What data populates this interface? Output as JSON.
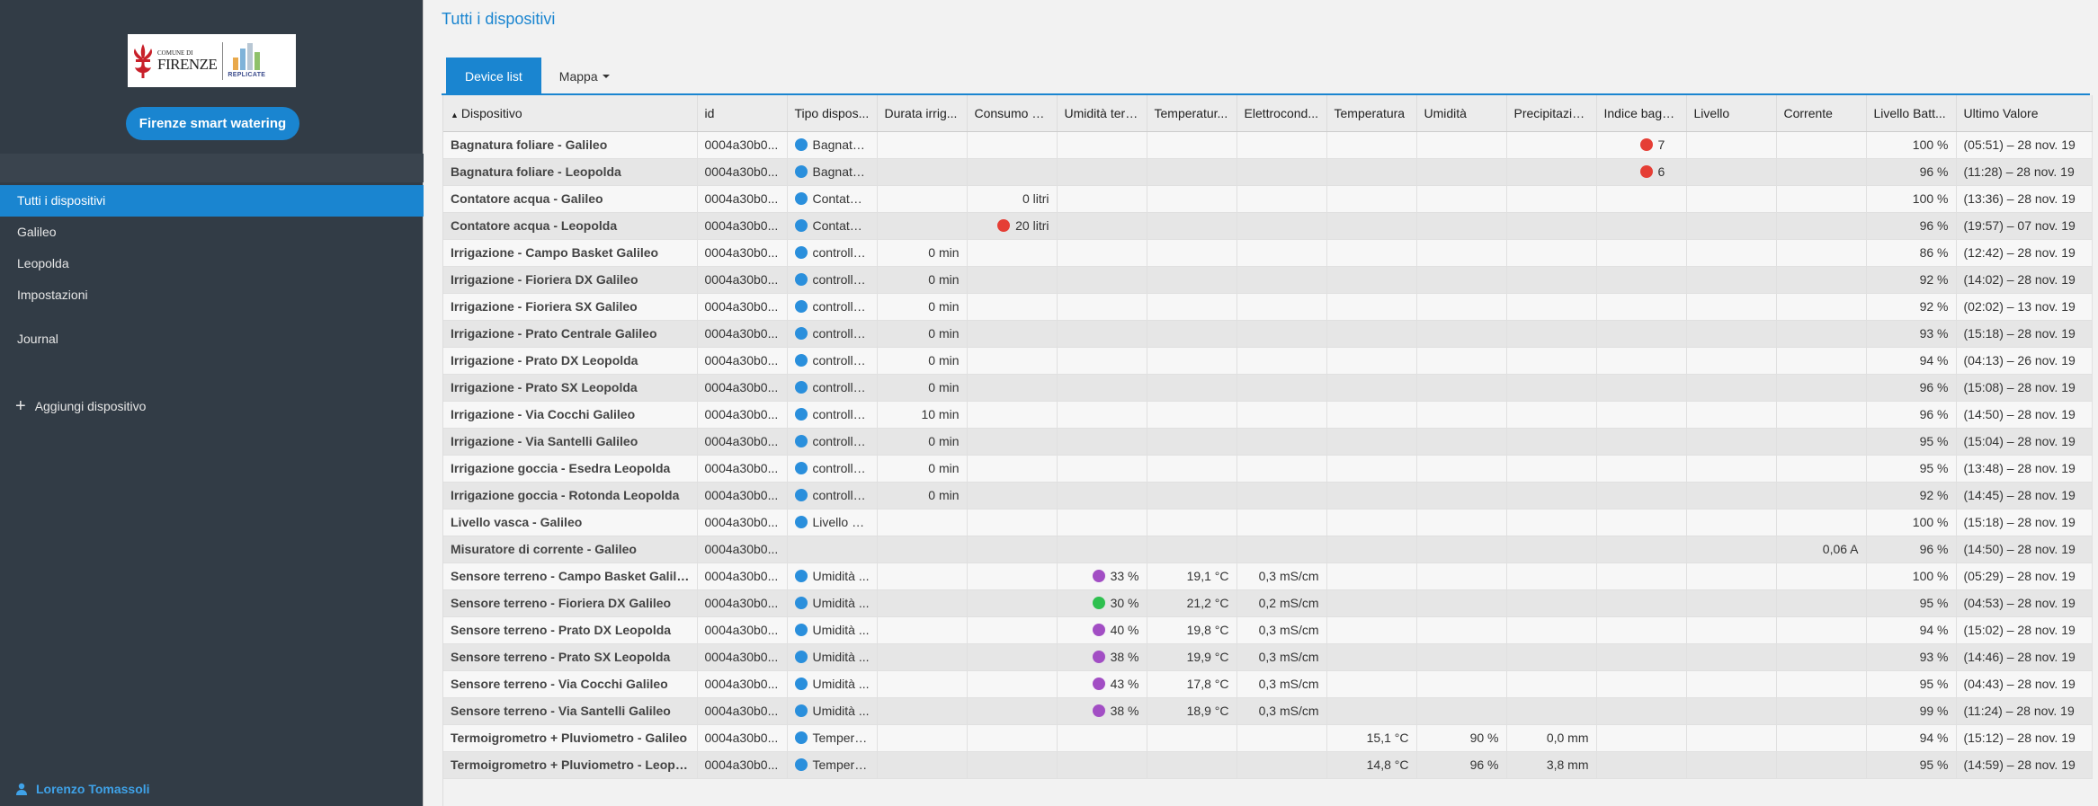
{
  "sidebar": {
    "logo": {
      "line1": "COMUNE DI",
      "line2": "FIRENZE",
      "partner": "REPLICATE"
    },
    "app_button": "Firenze smart watering",
    "nav": [
      {
        "label": "Tutti i dispositivi",
        "active": true
      },
      {
        "label": "Galileo"
      },
      {
        "label": "Leopolda"
      },
      {
        "label": "Impostazioni"
      },
      {
        "label": "Journal"
      }
    ],
    "add_device": "Aggiungi dispositivo",
    "user": "Lorenzo Tomassoli"
  },
  "main": {
    "title": "Tutti i dispositivi",
    "tabs": [
      {
        "label": "Device list",
        "active": true
      },
      {
        "label": "Mappa"
      }
    ]
  },
  "table": {
    "columns": [
      "Dispositivo",
      "id",
      "Tipo dispos...",
      "Durata irrig...",
      "Consumo a...",
      "Umidità terr...",
      "Temperatur...",
      "Elettrocond...",
      "Temperatura",
      "Umidità",
      "Precipitazio...",
      "Indice bagn...",
      "Livello",
      "Corrente",
      "Livello Batt...",
      "Ultimo Valore"
    ],
    "rows": [
      {
        "name": "Bagnatura foliare - Galileo",
        "id": "0004a30b0...",
        "type": "Bagnatu...",
        "durata": "",
        "consumo": "",
        "consumo_dot": "",
        "umid_terr": "",
        "umid_dot": "",
        "temp_terr": "",
        "ec": "",
        "temp": "",
        "umid": "",
        "prec": "",
        "indice": "7",
        "indice_dot": "red",
        "livello": "",
        "corrente": "",
        "batt": "100 %",
        "ultimo": "(05:51) – 28 nov. 19"
      },
      {
        "name": "Bagnatura foliare - Leopolda",
        "id": "0004a30b0...",
        "type": "Bagnatu...",
        "durata": "",
        "consumo": "",
        "consumo_dot": "",
        "umid_terr": "",
        "umid_dot": "",
        "temp_terr": "",
        "ec": "",
        "temp": "",
        "umid": "",
        "prec": "",
        "indice": "6",
        "indice_dot": "red",
        "livello": "",
        "corrente": "",
        "batt": "96 %",
        "ultimo": "(11:28) – 28 nov. 19"
      },
      {
        "name": "Contatore acqua - Galileo",
        "id": "0004a30b0...",
        "type": "Contator...",
        "durata": "",
        "consumo": "0 litri",
        "consumo_dot": "",
        "umid_terr": "",
        "umid_dot": "",
        "temp_terr": "",
        "ec": "",
        "temp": "",
        "umid": "",
        "prec": "",
        "indice": "",
        "indice_dot": "",
        "livello": "",
        "corrente": "",
        "batt": "100 %",
        "ultimo": "(13:36) – 28 nov. 19"
      },
      {
        "name": "Contatore acqua - Leopolda",
        "id": "0004a30b0...",
        "type": "Contator...",
        "durata": "",
        "consumo": "20 litri",
        "consumo_dot": "red",
        "umid_terr": "",
        "umid_dot": "",
        "temp_terr": "",
        "ec": "",
        "temp": "",
        "umid": "",
        "prec": "",
        "indice": "",
        "indice_dot": "",
        "livello": "",
        "corrente": "",
        "batt": "96 %",
        "ultimo": "(19:57) – 07 nov. 19"
      },
      {
        "name": "Irrigazione - Campo Basket Galileo",
        "id": "0004a30b0...",
        "type": "controlle...",
        "durata": "0 min",
        "consumo": "",
        "consumo_dot": "",
        "umid_terr": "",
        "umid_dot": "",
        "temp_terr": "",
        "ec": "",
        "temp": "",
        "umid": "",
        "prec": "",
        "indice": "",
        "indice_dot": "",
        "livello": "",
        "corrente": "",
        "batt": "86 %",
        "ultimo": "(12:42) – 28 nov. 19"
      },
      {
        "name": "Irrigazione - Fioriera DX Galileo",
        "id": "0004a30b0...",
        "type": "controlle...",
        "durata": "0 min",
        "consumo": "",
        "consumo_dot": "",
        "umid_terr": "",
        "umid_dot": "",
        "temp_terr": "",
        "ec": "",
        "temp": "",
        "umid": "",
        "prec": "",
        "indice": "",
        "indice_dot": "",
        "livello": "",
        "corrente": "",
        "batt": "92 %",
        "ultimo": "(14:02) – 28 nov. 19"
      },
      {
        "name": "Irrigazione - Fioriera SX Galileo",
        "id": "0004a30b0...",
        "type": "controlle...",
        "durata": "0 min",
        "consumo": "",
        "consumo_dot": "",
        "umid_terr": "",
        "umid_dot": "",
        "temp_terr": "",
        "ec": "",
        "temp": "",
        "umid": "",
        "prec": "",
        "indice": "",
        "indice_dot": "",
        "livello": "",
        "corrente": "",
        "batt": "92 %",
        "ultimo": "(02:02) – 13 nov. 19"
      },
      {
        "name": "Irrigazione - Prato Centrale Galileo",
        "id": "0004a30b0...",
        "type": "controlle...",
        "durata": "0 min",
        "consumo": "",
        "consumo_dot": "",
        "umid_terr": "",
        "umid_dot": "",
        "temp_terr": "",
        "ec": "",
        "temp": "",
        "umid": "",
        "prec": "",
        "indice": "",
        "indice_dot": "",
        "livello": "",
        "corrente": "",
        "batt": "93 %",
        "ultimo": "(15:18) – 28 nov. 19"
      },
      {
        "name": "Irrigazione - Prato DX Leopolda",
        "id": "0004a30b0...",
        "type": "controlle...",
        "durata": "0 min",
        "consumo": "",
        "consumo_dot": "",
        "umid_terr": "",
        "umid_dot": "",
        "temp_terr": "",
        "ec": "",
        "temp": "",
        "umid": "",
        "prec": "",
        "indice": "",
        "indice_dot": "",
        "livello": "",
        "corrente": "",
        "batt": "94 %",
        "ultimo": "(04:13) – 26 nov. 19"
      },
      {
        "name": "Irrigazione - Prato SX Leopolda",
        "id": "0004a30b0...",
        "type": "controlle...",
        "durata": "0 min",
        "consumo": "",
        "consumo_dot": "",
        "umid_terr": "",
        "umid_dot": "",
        "temp_terr": "",
        "ec": "",
        "temp": "",
        "umid": "",
        "prec": "",
        "indice": "",
        "indice_dot": "",
        "livello": "",
        "corrente": "",
        "batt": "96 %",
        "ultimo": "(15:08) – 28 nov. 19"
      },
      {
        "name": "Irrigazione - Via Cocchi Galileo",
        "id": "0004a30b0...",
        "type": "controlle...",
        "durata": "10 min",
        "consumo": "",
        "consumo_dot": "",
        "umid_terr": "",
        "umid_dot": "",
        "temp_terr": "",
        "ec": "",
        "temp": "",
        "umid": "",
        "prec": "",
        "indice": "",
        "indice_dot": "",
        "livello": "",
        "corrente": "",
        "batt": "96 %",
        "ultimo": "(14:50) – 28 nov. 19"
      },
      {
        "name": "Irrigazione - Via Santelli Galileo",
        "id": "0004a30b0...",
        "type": "controlle...",
        "durata": "0 min",
        "consumo": "",
        "consumo_dot": "",
        "umid_terr": "",
        "umid_dot": "",
        "temp_terr": "",
        "ec": "",
        "temp": "",
        "umid": "",
        "prec": "",
        "indice": "",
        "indice_dot": "",
        "livello": "",
        "corrente": "",
        "batt": "95 %",
        "ultimo": "(15:04) – 28 nov. 19"
      },
      {
        "name": "Irrigazione goccia - Esedra Leopolda",
        "id": "0004a30b0...",
        "type": "controlle...",
        "durata": "0 min",
        "consumo": "",
        "consumo_dot": "",
        "umid_terr": "",
        "umid_dot": "",
        "temp_terr": "",
        "ec": "",
        "temp": "",
        "umid": "",
        "prec": "",
        "indice": "",
        "indice_dot": "",
        "livello": "",
        "corrente": "",
        "batt": "95 %",
        "ultimo": "(13:48) – 28 nov. 19"
      },
      {
        "name": "Irrigazione goccia - Rotonda Leopolda",
        "id": "0004a30b0...",
        "type": "controlle...",
        "durata": "0 min",
        "consumo": "",
        "consumo_dot": "",
        "umid_terr": "",
        "umid_dot": "",
        "temp_terr": "",
        "ec": "",
        "temp": "",
        "umid": "",
        "prec": "",
        "indice": "",
        "indice_dot": "",
        "livello": "",
        "corrente": "",
        "batt": "92 %",
        "ultimo": "(14:45) – 28 nov. 19"
      },
      {
        "name": "Livello vasca - Galileo",
        "id": "0004a30b0...",
        "type": "Livello ul...",
        "durata": "",
        "consumo": "",
        "consumo_dot": "",
        "umid_terr": "",
        "umid_dot": "",
        "temp_terr": "",
        "ec": "",
        "temp": "",
        "umid": "",
        "prec": "",
        "indice": "",
        "indice_dot": "",
        "livello": "",
        "corrente": "",
        "batt": "100 %",
        "ultimo": "(15:18) – 28 nov. 19"
      },
      {
        "name": "Misuratore di corrente - Galileo",
        "id": "0004a30b0...",
        "type": "",
        "type_dot": "none",
        "durata": "",
        "consumo": "",
        "consumo_dot": "",
        "umid_terr": "",
        "umid_dot": "",
        "temp_terr": "",
        "ec": "",
        "temp": "",
        "umid": "",
        "prec": "",
        "indice": "",
        "indice_dot": "",
        "livello": "",
        "corrente": "0,06 A",
        "batt": "96 %",
        "ultimo": "(14:50) – 28 nov. 19"
      },
      {
        "name": "Sensore terreno - Campo Basket Galileo",
        "id": "0004a30b0...",
        "type": "Umidità ...",
        "durata": "",
        "consumo": "",
        "consumo_dot": "",
        "umid_terr": "33 %",
        "umid_dot": "purple",
        "temp_terr": "19,1 °C",
        "ec": "0,3 mS/cm",
        "temp": "",
        "umid": "",
        "prec": "",
        "indice": "",
        "indice_dot": "",
        "livello": "",
        "corrente": "",
        "batt": "100 %",
        "ultimo": "(05:29) – 28 nov. 19"
      },
      {
        "name": "Sensore terreno - Fioriera DX Galileo",
        "id": "0004a30b0...",
        "type": "Umidità ...",
        "durata": "",
        "consumo": "",
        "consumo_dot": "",
        "umid_terr": "30 %",
        "umid_dot": "green",
        "temp_terr": "21,2 °C",
        "ec": "0,2 mS/cm",
        "temp": "",
        "umid": "",
        "prec": "",
        "indice": "",
        "indice_dot": "",
        "livello": "",
        "corrente": "",
        "batt": "95 %",
        "ultimo": "(04:53) – 28 nov. 19"
      },
      {
        "name": "Sensore terreno - Prato DX Leopolda",
        "id": "0004a30b0...",
        "type": "Umidità ...",
        "durata": "",
        "consumo": "",
        "consumo_dot": "",
        "umid_terr": "40 %",
        "umid_dot": "purple",
        "temp_terr": "19,8 °C",
        "ec": "0,3 mS/cm",
        "temp": "",
        "umid": "",
        "prec": "",
        "indice": "",
        "indice_dot": "",
        "livello": "",
        "corrente": "",
        "batt": "94 %",
        "ultimo": "(15:02) – 28 nov. 19"
      },
      {
        "name": "Sensore terreno - Prato SX Leopolda",
        "id": "0004a30b0...",
        "type": "Umidità ...",
        "durata": "",
        "consumo": "",
        "consumo_dot": "",
        "umid_terr": "38 %",
        "umid_dot": "purple",
        "temp_terr": "19,9 °C",
        "ec": "0,3 mS/cm",
        "temp": "",
        "umid": "",
        "prec": "",
        "indice": "",
        "indice_dot": "",
        "livello": "",
        "corrente": "",
        "batt": "93 %",
        "ultimo": "(14:46) – 28 nov. 19"
      },
      {
        "name": "Sensore terreno - Via Cocchi Galileo",
        "id": "0004a30b0...",
        "type": "Umidità ...",
        "durata": "",
        "consumo": "",
        "consumo_dot": "",
        "umid_terr": "43 %",
        "umid_dot": "purple",
        "temp_terr": "17,8 °C",
        "ec": "0,3 mS/cm",
        "temp": "",
        "umid": "",
        "prec": "",
        "indice": "",
        "indice_dot": "",
        "livello": "",
        "corrente": "",
        "batt": "95 %",
        "ultimo": "(04:43) – 28 nov. 19"
      },
      {
        "name": "Sensore terreno - Via Santelli Galileo",
        "id": "0004a30b0...",
        "type": "Umidità ...",
        "durata": "",
        "consumo": "",
        "consumo_dot": "",
        "umid_terr": "38 %",
        "umid_dot": "purple",
        "temp_terr": "18,9 °C",
        "ec": "0,3 mS/cm",
        "temp": "",
        "umid": "",
        "prec": "",
        "indice": "",
        "indice_dot": "",
        "livello": "",
        "corrente": "",
        "batt": "99 %",
        "ultimo": "(11:24) – 28 nov. 19"
      },
      {
        "name": "Termoigrometro + Pluviometro - Galileo",
        "id": "0004a30b0...",
        "type": "Tempera...",
        "durata": "",
        "consumo": "",
        "consumo_dot": "",
        "umid_terr": "",
        "umid_dot": "",
        "temp_terr": "",
        "ec": "",
        "temp": "15,1 °C",
        "umid": "90 %",
        "prec": "0,0 mm",
        "indice": "",
        "indice_dot": "",
        "livello": "",
        "corrente": "",
        "batt": "94 %",
        "ultimo": "(15:12) – 28 nov. 19"
      },
      {
        "name": "Termoigrometro + Pluviometro - Leopolda",
        "id": "0004a30b0...",
        "type": "Tempera...",
        "durata": "",
        "consumo": "",
        "consumo_dot": "",
        "umid_terr": "",
        "umid_dot": "",
        "temp_terr": "",
        "ec": "",
        "temp": "14,8 °C",
        "umid": "96 %",
        "prec": "3,8 mm",
        "indice": "",
        "indice_dot": "",
        "livello": "",
        "corrente": "",
        "batt": "95 %",
        "ultimo": "(14:59) – 28 nov. 19"
      }
    ]
  }
}
